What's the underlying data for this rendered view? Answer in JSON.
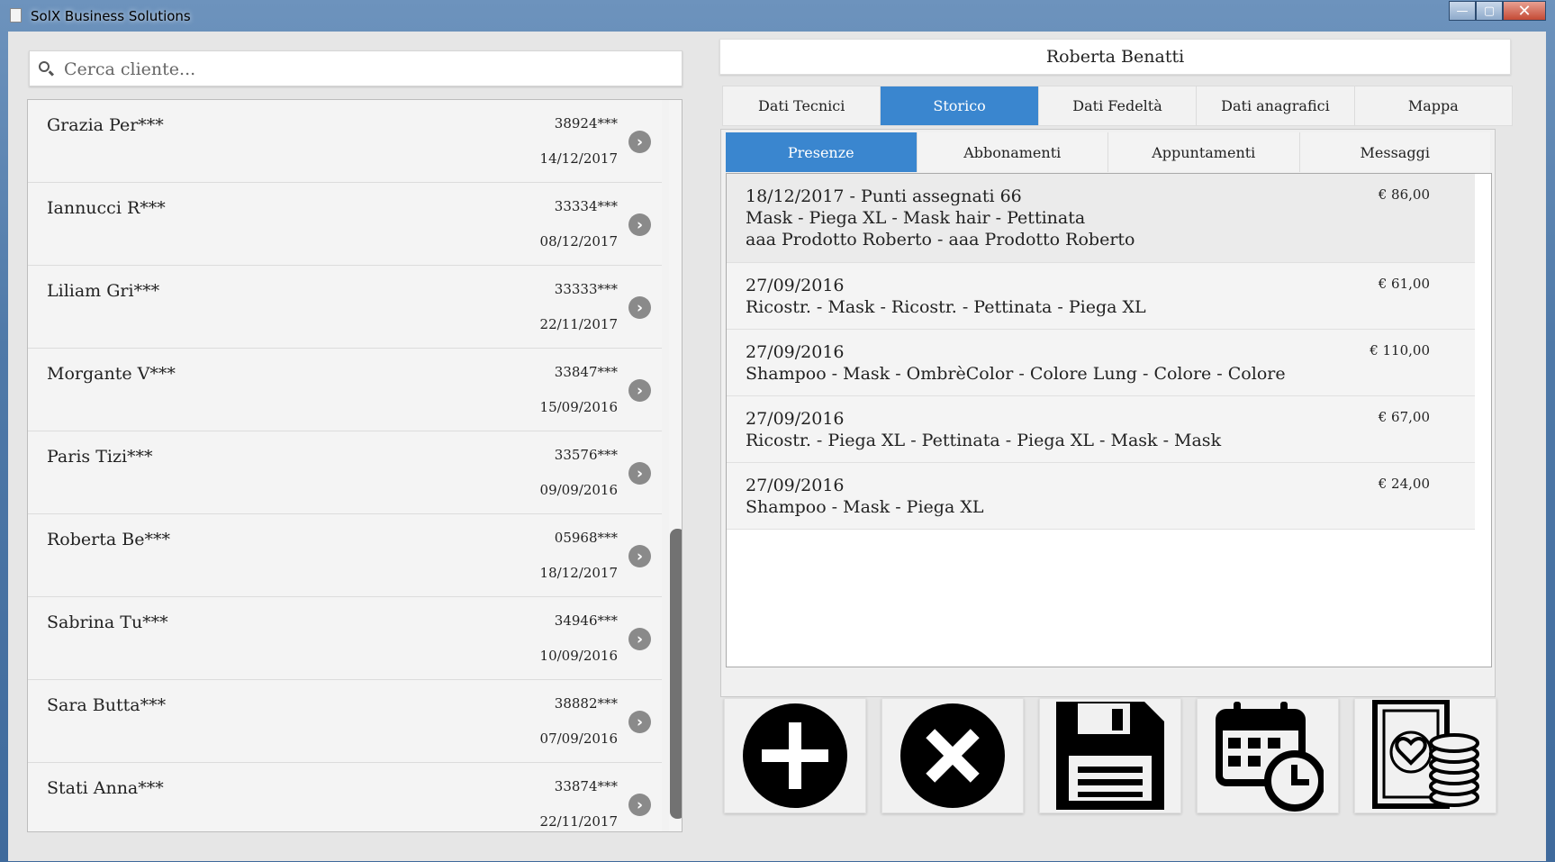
{
  "window": {
    "title": "SolX Business Solutions",
    "minimize_label": "—",
    "maximize_label": "▢",
    "close_label": "✕"
  },
  "search": {
    "placeholder": "Cerca cliente..."
  },
  "clients": [
    {
      "name": "Grazia Per***",
      "phone": "38924***",
      "date": "14/12/2017"
    },
    {
      "name": "Iannucci R***",
      "phone": "33334***",
      "date": "08/12/2017"
    },
    {
      "name": "Liliam Gri***",
      "phone": "33333***",
      "date": "22/11/2017"
    },
    {
      "name": "Morgante V***",
      "phone": "33847***",
      "date": "15/09/2016"
    },
    {
      "name": "Paris Tizi***",
      "phone": "33576***",
      "date": "09/09/2016"
    },
    {
      "name": "Roberta Be***",
      "phone": "05968***",
      "date": "18/12/2017"
    },
    {
      "name": "Sabrina Tu***",
      "phone": "34946***",
      "date": "10/09/2016"
    },
    {
      "name": "Sara Butta***",
      "phone": "38882***",
      "date": "07/09/2016"
    },
    {
      "name": "Stati Anna***",
      "phone": "33874***",
      "date": "22/11/2017"
    }
  ],
  "selected_client": {
    "full_name": "Roberta Benatti"
  },
  "tabs": [
    {
      "label": "Dati Tecnici",
      "active": false
    },
    {
      "label": "Storico",
      "active": true
    },
    {
      "label": "Dati Fedeltà",
      "active": false
    },
    {
      "label": "Dati anagrafici",
      "active": false
    },
    {
      "label": "Mappa",
      "active": false
    }
  ],
  "subtabs": [
    {
      "label": "Presenze",
      "active": true
    },
    {
      "label": "Abbonamenti",
      "active": false
    },
    {
      "label": "Appuntamenti",
      "active": false
    },
    {
      "label": "Messaggi",
      "active": false
    }
  ],
  "history": [
    {
      "lines": [
        "18/12/2017 - Punti assegnati 66",
        "Mask - Piega XL - Mask hair - Pettinata",
        "aaa Prodotto Roberto - aaa Prodotto Roberto"
      ],
      "price": "€ 86,00"
    },
    {
      "lines": [
        "27/09/2016",
        "Ricostr. - Mask - Ricostr. - Pettinata - Piega XL"
      ],
      "price": "€ 61,00"
    },
    {
      "lines": [
        "27/09/2016",
        "Shampoo - Mask - OmbrèColor - Colore Lung - Colore - Colore"
      ],
      "price": "€ 110,00"
    },
    {
      "lines": [
        "27/09/2016",
        "Ricostr. - Piega XL - Pettinata - Piega XL - Mask - Mask"
      ],
      "price": "€ 67,00"
    },
    {
      "lines": [
        "27/09/2016",
        "Shampoo - Mask - Piega XL"
      ],
      "price": "€ 24,00"
    }
  ],
  "actions": [
    {
      "name": "add-button",
      "icon": "plus-circle-icon"
    },
    {
      "name": "delete-button",
      "icon": "x-circle-icon"
    },
    {
      "name": "save-button",
      "icon": "floppy-disk-icon"
    },
    {
      "name": "schedule-button",
      "icon": "calendar-clock-icon"
    },
    {
      "name": "payment-button",
      "icon": "money-coins-icon"
    }
  ]
}
